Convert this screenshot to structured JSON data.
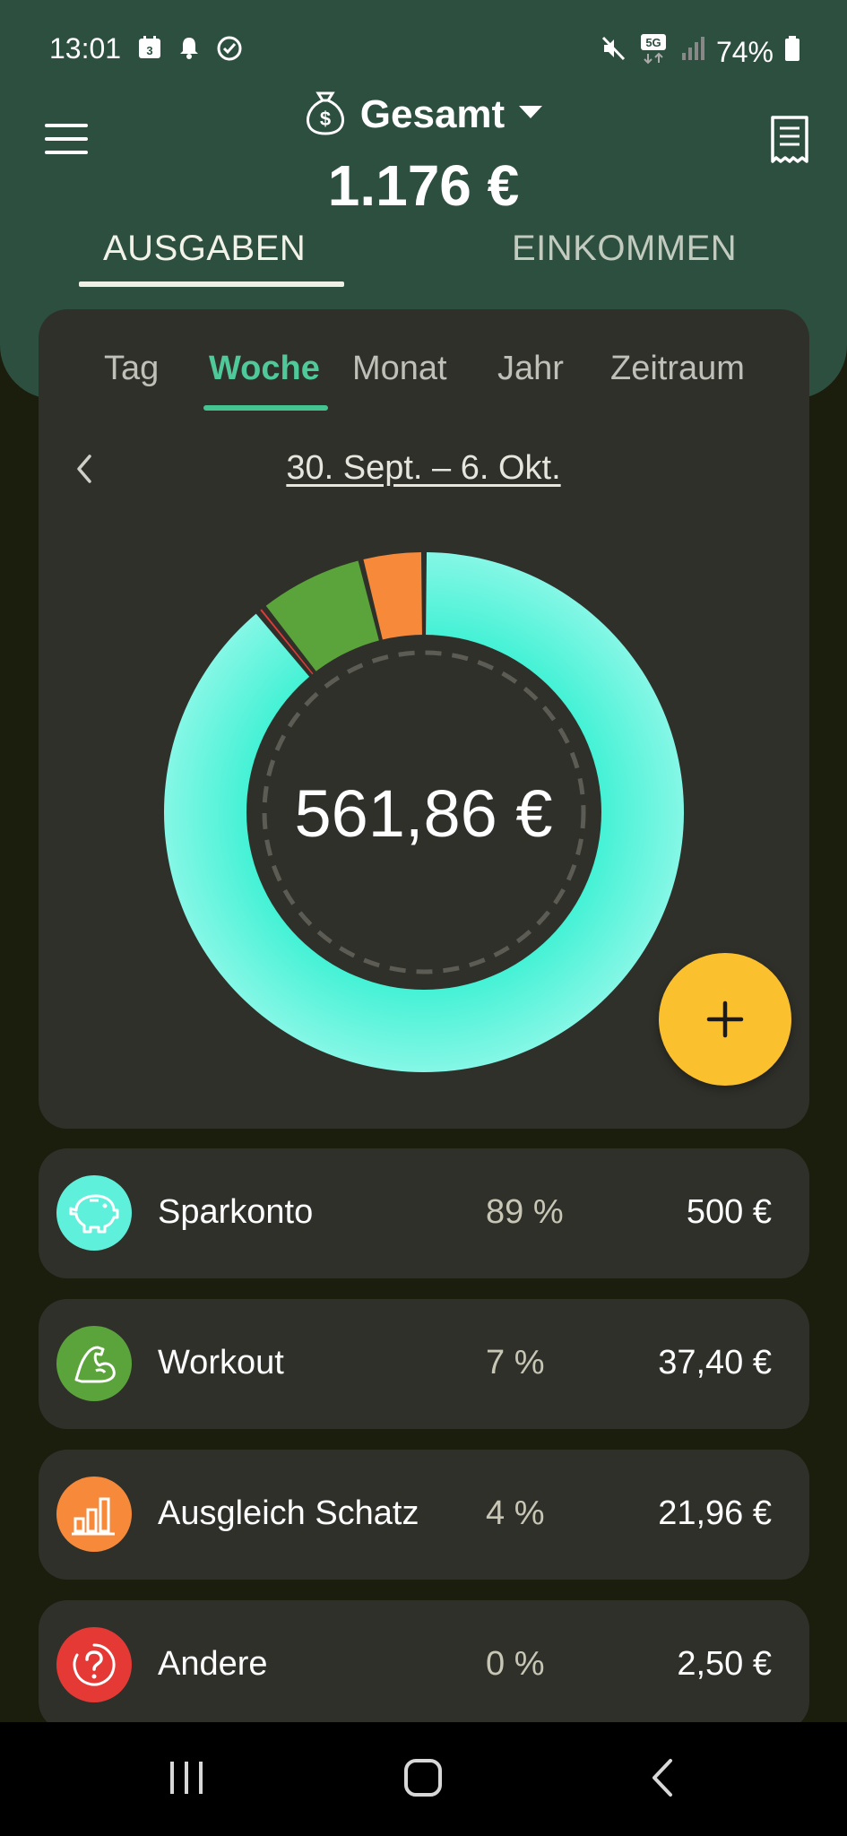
{
  "status_bar": {
    "time": "13:01",
    "calendar_day": "3",
    "network": "5G",
    "battery": "74%"
  },
  "header": {
    "account_name": "Gesamt",
    "total_amount": "1.176 €"
  },
  "main_tabs": [
    {
      "label": "AUSGABEN",
      "active": true
    },
    {
      "label": "EINKOMMEN",
      "active": false
    }
  ],
  "period_tabs": [
    {
      "label": "Tag",
      "active": false
    },
    {
      "label": "Woche",
      "active": true
    },
    {
      "label": "Monat",
      "active": false
    },
    {
      "label": "Jahr",
      "active": false
    },
    {
      "label": "Zeitraum",
      "active": false
    }
  ],
  "date_range": "30. Sept. – 6. Okt.",
  "chart_data": {
    "type": "pie",
    "center_label": "561,86 €",
    "slices": [
      {
        "name": "Sparkonto",
        "value": 500,
        "color": "#5ff0dc"
      },
      {
        "name": "Andere",
        "value": 2.5,
        "color": "#e53935"
      },
      {
        "name": "Workout",
        "value": 37.4,
        "color": "#5ba33b"
      },
      {
        "name": "Ausgleich Schatz",
        "value": 21.96,
        "color": "#f78a3a"
      }
    ]
  },
  "categories": [
    {
      "name": "Sparkonto",
      "percent": "89 %",
      "amount": "500 €",
      "color": "#5ff0dc",
      "icon": "piggy-bank-icon"
    },
    {
      "name": "Workout",
      "percent": "7 %",
      "amount": "37,40 €",
      "color": "#5ba33b",
      "icon": "muscle-arm-icon"
    },
    {
      "name": "Ausgleich Schatz",
      "percent": "4 %",
      "amount": "21,96 €",
      "color": "#f78a3a",
      "icon": "bar-chart-icon"
    },
    {
      "name": "Andere",
      "percent": "0 %",
      "amount": "2,50 €",
      "color": "#e53935",
      "icon": "question-mark-icon"
    }
  ],
  "colors": {
    "header": "#2c4f3f",
    "background": "#1b1d0d",
    "card": "#30302b",
    "accent": "#4fc89a",
    "fab": "#fbc02d"
  }
}
